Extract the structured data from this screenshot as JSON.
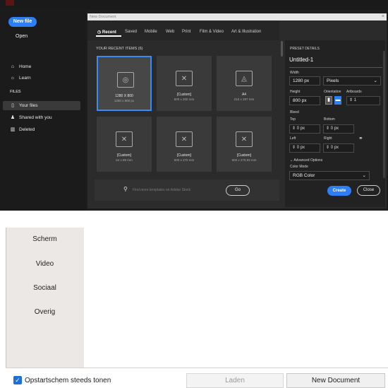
{
  "sidebar": {
    "new_file": "New file",
    "open": "Open",
    "home": "Home",
    "learn": "Learn",
    "files_section": "FILES",
    "your_files": "Your files",
    "shared": "Shared with you",
    "deleted": "Deleted"
  },
  "dialog": {
    "title": "New Document",
    "tabs": [
      "Recent",
      "Saved",
      "Mobile",
      "Web",
      "Print",
      "Film & Video",
      "Art & Illustration"
    ],
    "recent_heading": "YOUR RECENT ITEMS",
    "recent_count": "(6)",
    "cards": [
      {
        "name": "1280 X 800",
        "size": "1280 x 800 px",
        "icon": "web-icon"
      },
      {
        "name": "[Custom]",
        "size": "600 x 200 mm",
        "icon": "document-icon"
      },
      {
        "name": "A4",
        "size": "210 x 297 mm",
        "icon": "print-icon"
      },
      {
        "name": "[Custom]",
        "size": "64 x 89 mm",
        "icon": "document-icon"
      },
      {
        "name": "[Custom]",
        "size": "600 x 270 mm",
        "icon": "document-icon"
      },
      {
        "name": "[Custom]",
        "size": "600 x 270,93 mm",
        "icon": "document-icon"
      }
    ],
    "search_placeholder": "Find more templates on Adobe Stock",
    "go": "Go"
  },
  "preset": {
    "heading": "PRESET DETAILS",
    "name": "Untitled-1",
    "width_label": "Width",
    "width": "1280 px",
    "unit": "Pixels",
    "height_label": "Height",
    "height": "800 px",
    "orientation_label": "Orientation",
    "artboards_label": "Artboards",
    "artboards": "1",
    "bleed_label": "Bleed",
    "top_label": "Top",
    "bottom_label": "Bottom",
    "left_label": "Left",
    "right_label": "Right",
    "top": "0 px",
    "bottom": "0 px",
    "left": "0 px",
    "right": "0 px",
    "advanced": "Advanced Options",
    "color_mode_label": "Color Mode",
    "color_mode": "RGB Color",
    "create": "Create",
    "close": "Close"
  },
  "lower": {
    "categories": [
      "Scherm",
      "Video",
      "Sociaal",
      "Overig"
    ],
    "startup_checkbox": "Opstartschem steeds tonen",
    "load_button": "Laden",
    "new_doc_button": "New Document"
  },
  "colors": {
    "accent": "#2d7ff9",
    "panel": "#2b2b2b",
    "checkbox": "#1f6fd6"
  }
}
